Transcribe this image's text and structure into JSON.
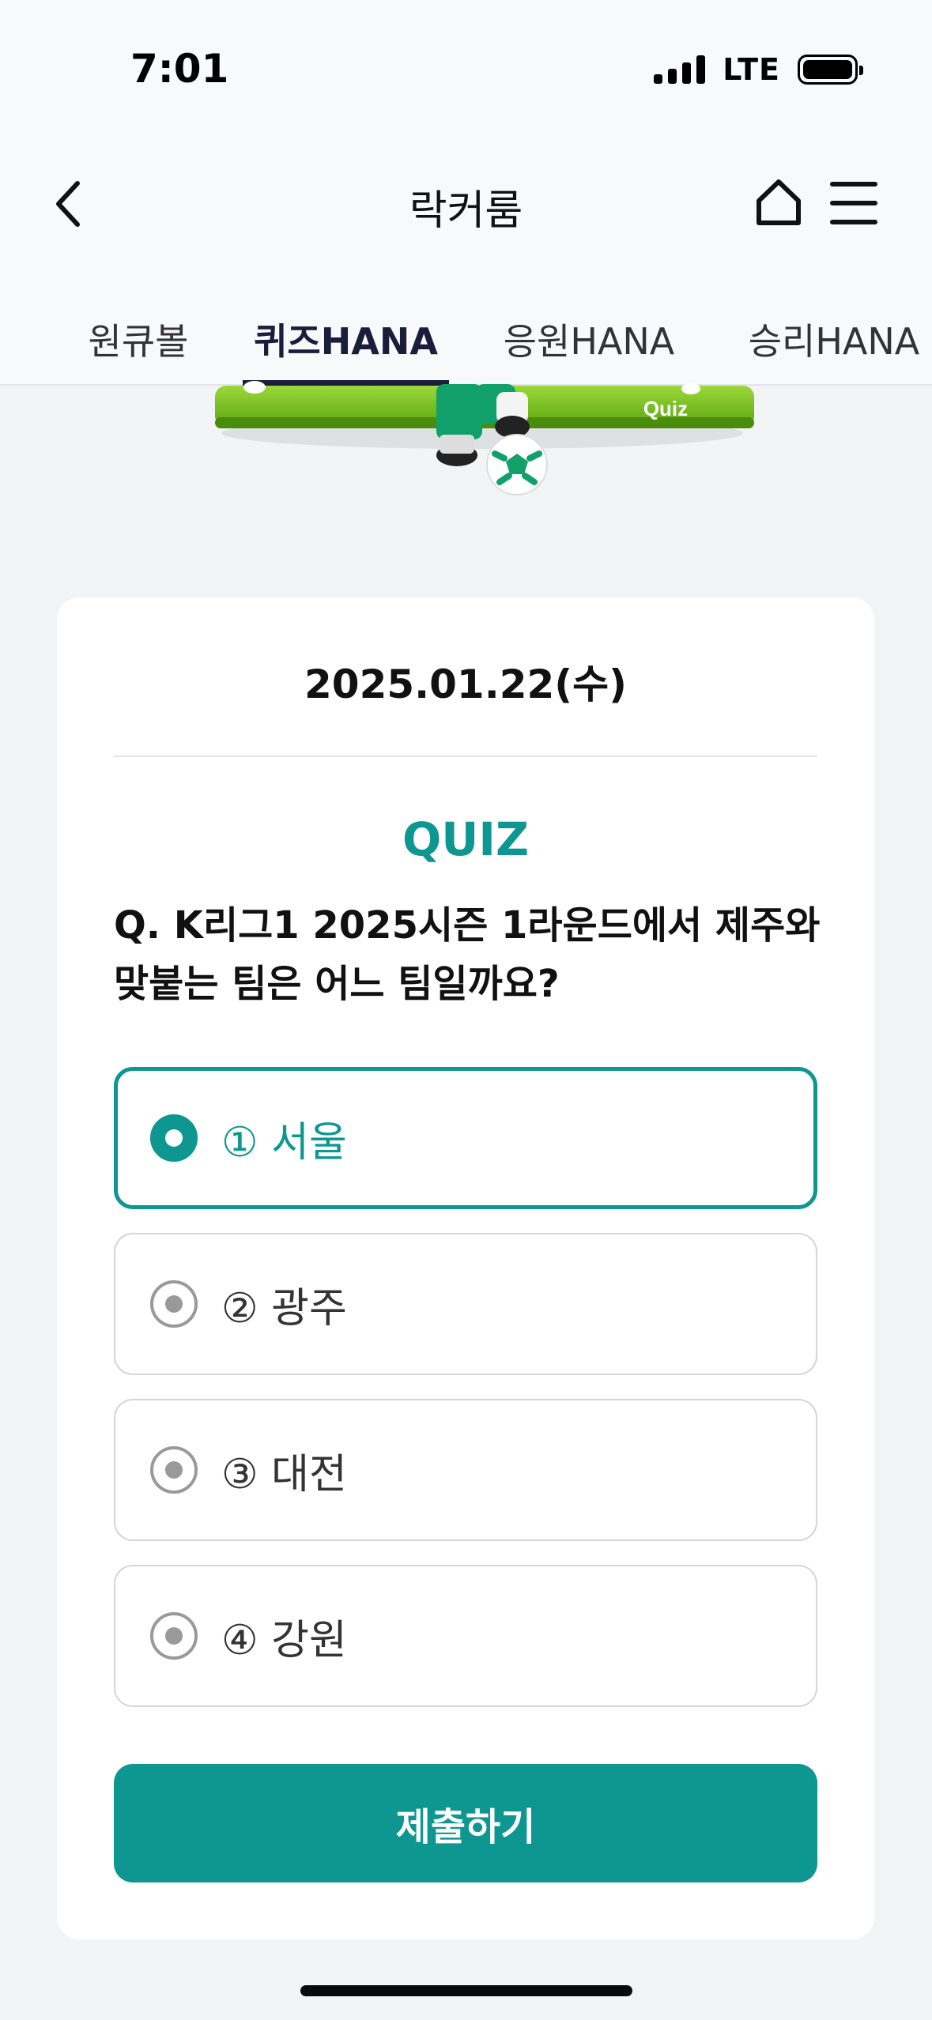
{
  "status_bar": {
    "time": "7:01",
    "network": "LTE"
  },
  "header": {
    "title": "락커룸"
  },
  "tabs": [
    {
      "label": "원큐볼",
      "active": false
    },
    {
      "label": "퀴즈HANA",
      "active": true
    },
    {
      "label": "응원HANA",
      "active": false
    },
    {
      "label": "승리HANA",
      "active": false
    }
  ],
  "banner": {
    "badge_text": "Quiz"
  },
  "quiz": {
    "date": "2025.01.22(수)",
    "label": "QUIZ",
    "question": "Q. K리그1 2025시즌 1라운드에서 제주와 맞붙는 팀은 어느 팀일까요?",
    "options": [
      {
        "label": "① 서울",
        "selected": true
      },
      {
        "label": "② 광주",
        "selected": false
      },
      {
        "label": "③ 대전",
        "selected": false
      },
      {
        "label": "④ 강원",
        "selected": false
      }
    ],
    "submit_label": "제출하기"
  },
  "colors": {
    "accent": "#0e9690",
    "tab_active": "#1b1d3a",
    "banner_green": "#7cc41f"
  }
}
